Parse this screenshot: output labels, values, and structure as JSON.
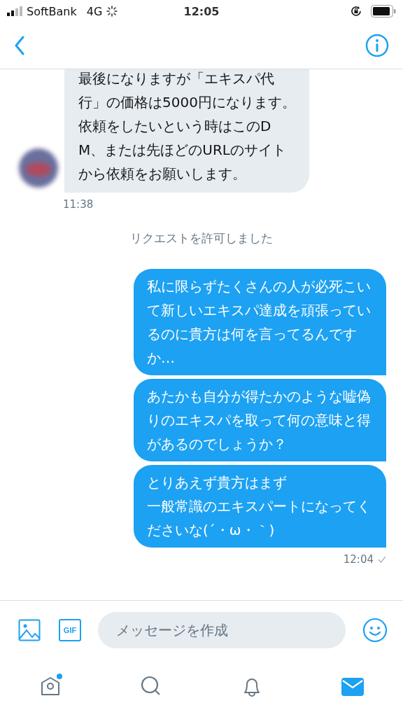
{
  "status_bar": {
    "carrier": "SoftBank",
    "network": "4G",
    "time": "12:05"
  },
  "messages": [
    {
      "kind": "incoming",
      "paragraphs": [
        "最後になりますが「エキスパ代行」の価格は5000円になります。",
        "依頼をしたいという時はこのDM、または先ほどのURLのサイトから依頼をお願いします。"
      ],
      "time": "11:38"
    },
    {
      "kind": "notice",
      "text": "リクエストを許可しました"
    },
    {
      "kind": "outgoing",
      "paragraphs": [
        "私に限らずたくさんの人が必死こいて新しいエキスパ達成を頑張っているのに貴方は何を言ってるんですか…"
      ]
    },
    {
      "kind": "outgoing",
      "paragraphs": [
        "あたかも自分が得たかのような嘘偽りのエキスパを取って何の意味と得があるのでしょうか？"
      ]
    },
    {
      "kind": "outgoing",
      "paragraphs": [
        "とりあえず貴方はまず",
        "一般常識のエキスパートになってくださいな(´・ω・｀)"
      ],
      "time": "12:04",
      "read": true
    }
  ],
  "composer": {
    "gif_label": "GIF",
    "placeholder": "メッセージを作成"
  },
  "tab_bar": [
    {
      "kind": "home",
      "selected": false,
      "badge": true
    },
    {
      "kind": "search",
      "selected": false,
      "badge": false
    },
    {
      "kind": "notifications",
      "selected": false,
      "badge": false
    },
    {
      "kind": "messages",
      "selected": true,
      "badge": false
    }
  ]
}
